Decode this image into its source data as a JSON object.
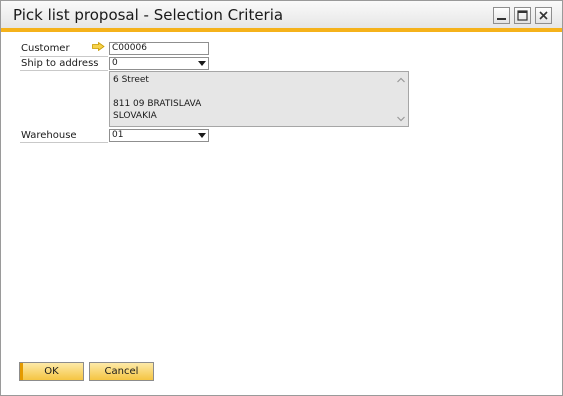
{
  "window": {
    "title": "Pick list proposal - Selection Criteria",
    "accent_color": "#f5b21b"
  },
  "form": {
    "customer_label": "Customer",
    "customer_value": "C00006",
    "ship_to_label": "Ship to address",
    "ship_to_value": "0",
    "address_lines": [
      "6 Street",
      "",
      "811 09 BRATISLAVA",
      "SLOVAKIA"
    ],
    "warehouse_label": "Warehouse",
    "warehouse_value": "01"
  },
  "buttons": {
    "ok_label": "OK",
    "cancel_label": "Cancel"
  },
  "icons": {
    "link_arrow": "link-arrow-icon",
    "minimize": "minimize-icon",
    "maximize": "maximize-icon",
    "close": "close-icon",
    "dropdown": "chevron-down-icon",
    "scroll_up": "scroll-up-icon",
    "scroll_down": "scroll-down-icon"
  }
}
